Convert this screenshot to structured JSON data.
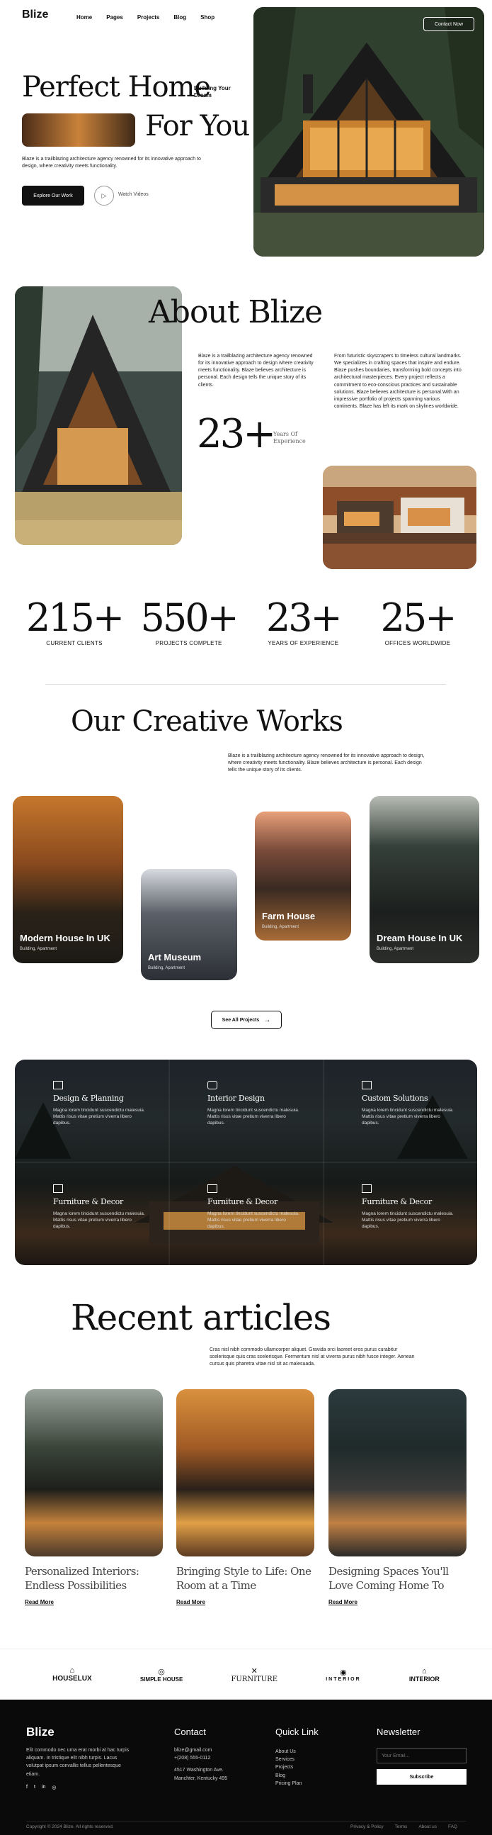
{
  "header": {
    "logo": "Blize",
    "nav": [
      "Home",
      "Pages",
      "Projects",
      "Blog",
      "Shop"
    ],
    "contact_label": "Contact Now"
  },
  "hero": {
    "title_line1": "Perfect Home",
    "tag": "Building Your Dream",
    "title_line2": "For You",
    "desc": "Blaze is a trailblazing architecture agency renowned for its innovative approach to design, where creativity meets functionality.",
    "explore_label": "Explore Our Work",
    "watch_label": "Watch Videos"
  },
  "about": {
    "title": "About Blize",
    "p1": "Blaze is a trailblazing architecture agency renowned for its innovative approach to design where creativity meets functionality. Blaze believes architecture is personal. Each design tells the unique story of its clients.",
    "p2": "From futuristic skyscrapers to timeless cultural landmarks. We specializes in crafting spaces that inspire and endure. Blaze pushes boundaries, transforming bold concepts into architectural masterpieces. Every project reflects a commitment to eco-conscious practices and sustainable solutions. Blaze believes architecture is personal.With an impressive portfolio of projects spanning various continents. Blaze has left its mark on skylines worldwide.",
    "years_num": "23+",
    "years_label": "Years Of Experience"
  },
  "stats": [
    {
      "num": "215+",
      "label": "CURRENT CLIENTS"
    },
    {
      "num": "550+",
      "label": "PROJECTS COMPLETE"
    },
    {
      "num": "23+",
      "label": "YEARS OF EXPERIENCE"
    },
    {
      "num": "25+",
      "label": "OFFICES WORLDWIDE"
    }
  ],
  "works": {
    "title": "Our Creative Works",
    "desc": "Blaze is a trailblazing architecture agency renowned for its innovative approach to design, where creativity meets functionality. Blaze believes architecture is personal. Each design tells the unique story of its clients.",
    "cards": [
      {
        "title": "Modern House In UK",
        "sub": "Building, Apartment"
      },
      {
        "title": "Art Museum",
        "sub": "Building, Apartment"
      },
      {
        "title": "Farm House",
        "sub": "Building, Apartment"
      },
      {
        "title": "Dream House In UK",
        "sub": "Building, Apartment"
      }
    ],
    "see_all": "See All Projects"
  },
  "services": [
    {
      "title": "Design & Planning",
      "text": "Magna lorem tincidunt suscendictu malesuia. Mattis risus vitae pretium viverra libero dapibus."
    },
    {
      "title": "Interior Design",
      "text": "Magna lorem tincidunt suscendictu malesuia. Mattis risus vitae pretium viverra libero dapibus."
    },
    {
      "title": "Custom Solutions",
      "text": "Magna lorem tincidunt suscendictu malesuia. Mattis risus vitae pretium viverra libero dapibus."
    },
    {
      "title": "Furniture & Decor",
      "text": "Magna lorem tincidunt suscendictu malesuia. Mattis risus vitae pretium viverra libero dapibus."
    },
    {
      "title": "Furniture & Decor",
      "text": "Magna lorem tincidunt suscendictu malesuia. Mattis risus vitae pretium viverra libero dapibus."
    },
    {
      "title": "Furniture & Decor",
      "text": "Magna lorem tincidunt suscendictu malesuia. Mattis risus vitae pretium viverra libero dapibus."
    }
  ],
  "articles": {
    "title": "Recent articles",
    "desc": "Cras nisl nibh commodo ullamcorper aliquet. Gravida orci laoreet eros purus curabitur scelerisque quis cras scelerisque. Fermentum nisl at viverra purus nibh fusce integer. Aenean cursus quis pharetra vitae nisl sit ac malesuada.",
    "items": [
      {
        "title": "Personalized Interiors: Endless Possibilities",
        "read": "Read More"
      },
      {
        "title": "Bringing Style to Life: One Room at a Time",
        "read": "Read More"
      },
      {
        "title": "Designing Spaces You'll Love Coming Home To",
        "read": "Read More"
      }
    ]
  },
  "brands": [
    "HOUSELUX",
    "SIMPLE HOUSE",
    "FURNITURE",
    "INTERIOR",
    "INTERIOR"
  ],
  "footer": {
    "logo": "Blize",
    "about": "Elit commodo nec urna erat morbi at hac turpis aliquam. In tristique elit nibh turpis. Lacus volutpat ipsum convallis tellus pellentesque etiam.",
    "contact_h": "Contact",
    "email": "blize@gmail.com",
    "phone": "+(208) 555-0112",
    "addr1": "4517 Washington Ave.",
    "addr2": "Manchter, Kentucky 495",
    "quick_h": "Quick Link",
    "links": [
      "About Us",
      "Services",
      "Projects",
      "Blog",
      "Pricing Plan"
    ],
    "news_h": "Newsletter",
    "email_placeholder": "Your Email...",
    "subscribe": "Subscribe",
    "copyright": "Copyright © 2024 Blize. All rights reserved.",
    "bottom_links": [
      "Privacy & Policy",
      "Terms",
      "About us",
      "FAQ"
    ]
  }
}
